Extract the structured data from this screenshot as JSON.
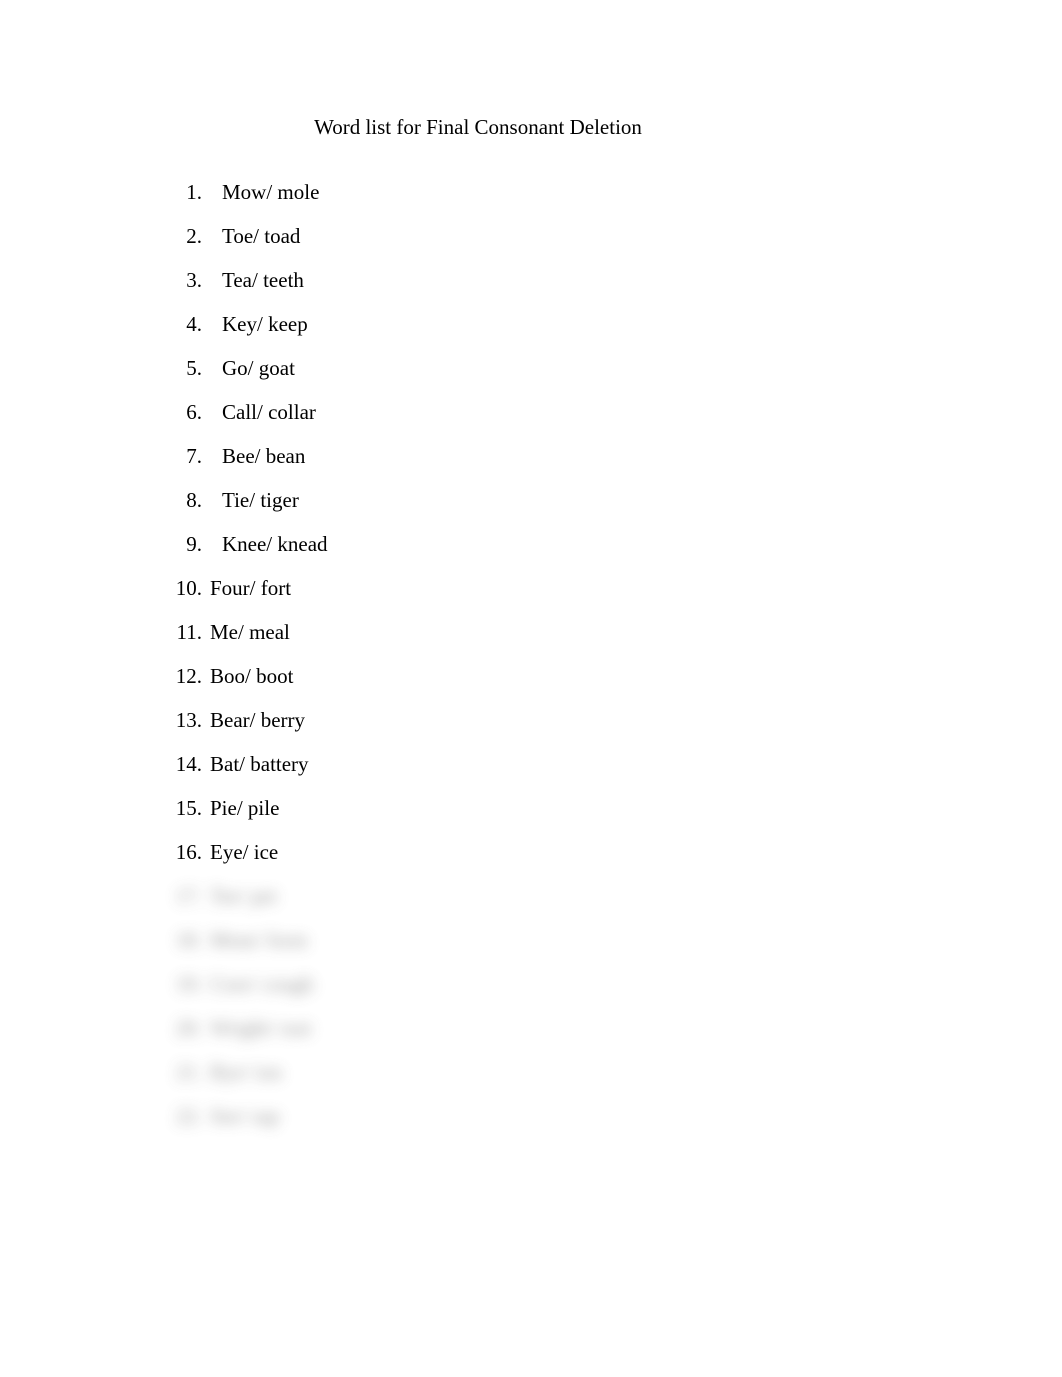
{
  "title": "Word list for Final Consonant Deletion",
  "items": [
    {
      "number": "1.",
      "text": "Mow/ mole",
      "blurred": false
    },
    {
      "number": "2.",
      "text": "Toe/ toad",
      "blurred": false
    },
    {
      "number": "3.",
      "text": "Tea/ teeth",
      "blurred": false
    },
    {
      "number": "4.",
      "text": "Key/ keep",
      "blurred": false
    },
    {
      "number": "5.",
      "text": "Go/ goat",
      "blurred": false
    },
    {
      "number": "6.",
      "text": "Call/ collar",
      "blurred": false
    },
    {
      "number": "7.",
      "text": "Bee/ bean",
      "blurred": false
    },
    {
      "number": "8.",
      "text": "Tie/ tiger",
      "blurred": false
    },
    {
      "number": "9.",
      "text": "Knee/ knead",
      "blurred": false
    },
    {
      "number": "10.",
      "text": "Four/ fort",
      "blurred": false
    },
    {
      "number": "11.",
      "text": "Me/ meal",
      "blurred": false
    },
    {
      "number": "12.",
      "text": "Boo/ boot",
      "blurred": false
    },
    {
      "number": "13.",
      "text": "Bear/ berry",
      "blurred": false
    },
    {
      "number": "14.",
      "text": "Bat/ battery",
      "blurred": false
    },
    {
      "number": "15.",
      "text": "Pie/ pile",
      "blurred": false
    },
    {
      "number": "16.",
      "text": "Eye/ ice",
      "blurred": false
    },
    {
      "number": "17.",
      "text": "Tee/ pet",
      "blurred": true
    },
    {
      "number": "18.",
      "text": "Mom/ form",
      "blurred": true
    },
    {
      "number": "19.",
      "text": "Core/ cough",
      "blurred": true
    },
    {
      "number": "20.",
      "text": "Wright/ rust",
      "blurred": true
    },
    {
      "number": "21.",
      "text": "Bye/ ion",
      "blurred": true
    },
    {
      "number": "22.",
      "text": "See/ sap",
      "blurred": true
    }
  ]
}
